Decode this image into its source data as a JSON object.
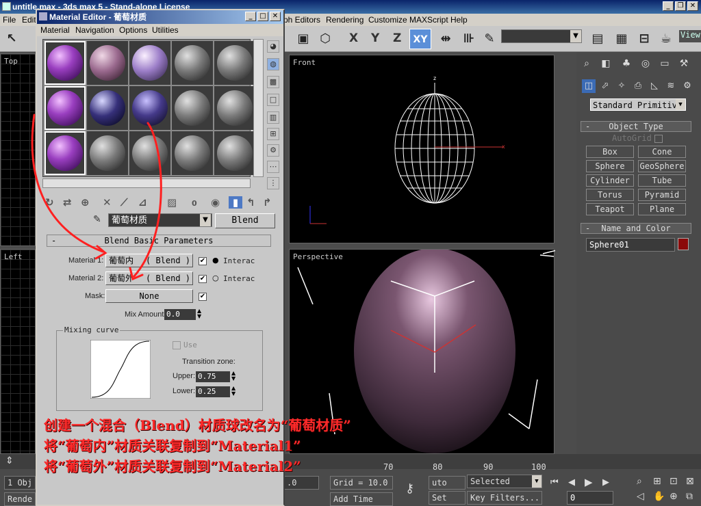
{
  "main_window": {
    "title": "untitle.max - 3ds max 5 - Stand-alone License",
    "menu": [
      "File",
      "Edit",
      "ph Editors",
      "Rendering",
      "Customize",
      "MAXScript",
      "Help"
    ],
    "axes": [
      "X",
      "Y",
      "Z"
    ],
    "active_axis": "XY",
    "view_label": "View"
  },
  "viewports": {
    "top": "Top",
    "left": "Left",
    "front": "Front",
    "perspective": "Perspective"
  },
  "material_editor": {
    "title": "Material Editor - 葡萄材质",
    "menu": [
      "Material",
      "Navigation",
      "Options",
      "Utilities"
    ],
    "material_name": "葡萄材质",
    "material_type": "Blend",
    "blend_rollout": "Blend Basic Parameters",
    "material1_label": "Material 1:",
    "material1_value": "葡萄内",
    "material1_type": "( Blend )",
    "material2_label": "Material 2:",
    "material2_value": "葡萄外",
    "material2_type": "( Blend )",
    "interactive": "Interac",
    "mask_label": "Mask:",
    "mask_value": "None",
    "mix_amount_label": "Mix Amount:",
    "mix_amount_value": "0.0",
    "mixing_curve_title": "Mixing curve",
    "use_label": "Use",
    "transition_zone": "Transition zone:",
    "upper_label": "Upper:",
    "upper_value": "0.75",
    "lower_label": "Lower:",
    "lower_value": "0.25",
    "slot_zero": "0"
  },
  "command_panel": {
    "category": "Standard Primitiv",
    "object_type_header": "Object Type",
    "autogrid": "AutoGrid",
    "primitives": [
      "Box",
      "Cone",
      "Sphere",
      "GeoSphere",
      "Cylinder",
      "Tube",
      "Torus",
      "Pyramid",
      "Teapot",
      "Plane"
    ],
    "name_color_header": "Name and Color",
    "object_name": "Sphere01",
    "object_color": "#8b0a0a"
  },
  "status": {
    "objects": "1 Obj",
    "render": "Rende",
    "frame_ticks": [
      "70",
      "80",
      "90",
      "100"
    ],
    "grid": "Grid = 10.0",
    "add_time_tag": "Add Time Tag",
    "auto_key": "uto Key",
    "set_key": "Set Key",
    "key_mode": "Selected",
    "key_filters": "Key Filters...",
    "frame": "0",
    "coord": ".0"
  },
  "annotation": {
    "line1": "创建一个混合（Blend）材质球改名为“葡萄材质”",
    "line2": "将“葡萄内”材质关联复制到“Material1”",
    "line3": "将“葡萄外”材质关联复制到“Material2”",
    "color": "#ff2a2a"
  }
}
